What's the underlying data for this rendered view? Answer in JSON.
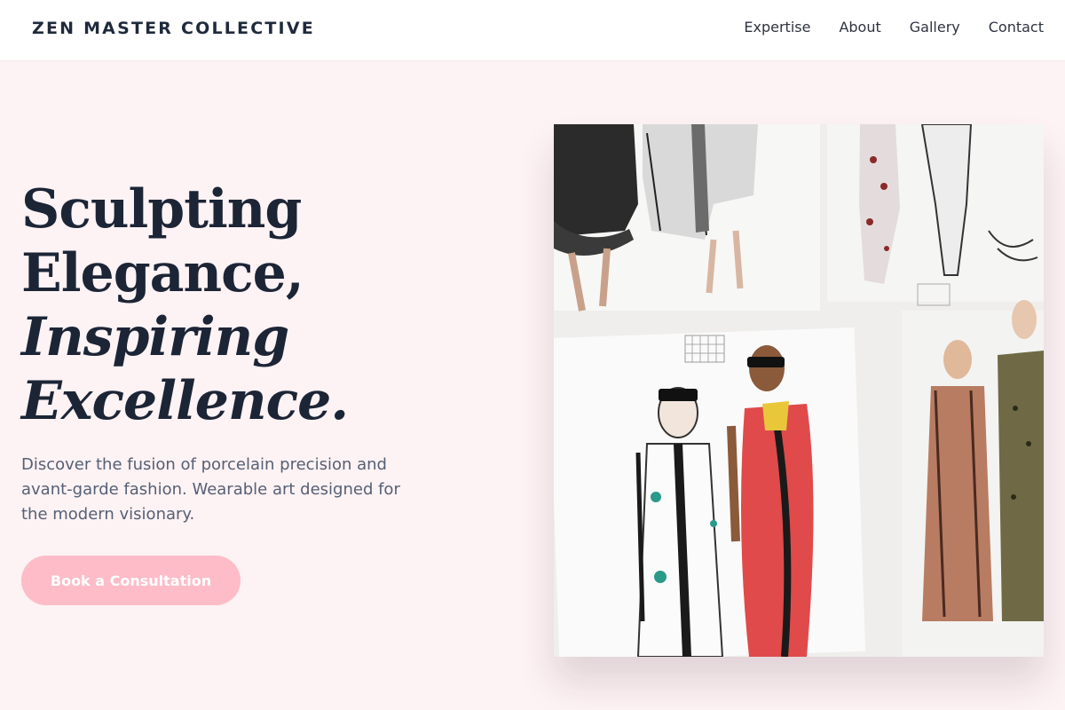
{
  "header": {
    "brand": "ZEN MASTER COLLECTIVE",
    "nav": [
      "Expertise",
      "About",
      "Gallery",
      "Contact"
    ]
  },
  "hero": {
    "headline": [
      "Sculpting",
      "Elegance,",
      "Inspiring",
      "Excellence."
    ],
    "subtext": "Discover the fusion of porcelain precision and avant-garde fashion. Wearable art designed for the modern visionary.",
    "cta_label": "Book a Consultation"
  },
  "image": {
    "description_icon": "fashion-sketches-illustration"
  },
  "colors": {
    "background": "#fdf2f4",
    "header_bg": "#ffffff",
    "heading": "#1c2536",
    "body_text": "#566074",
    "cta_bg": "#fdbcc8",
    "cta_text": "#ffffff"
  }
}
